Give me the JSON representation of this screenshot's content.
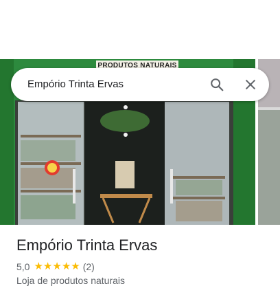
{
  "colors": {
    "accent_star": "#fbbc04",
    "storefront_green": "#2d8a3e"
  },
  "photo": {
    "sign_text": "PRODUTOS NATURAIS"
  },
  "search": {
    "query": "Empório Trinta Ervas",
    "search_icon": "search-icon",
    "close_icon": "close-icon"
  },
  "place": {
    "name": "Empório Trinta Ervas",
    "rating": "5,0",
    "stars": 5,
    "review_count": "(2)",
    "category": "Loja de produtos naturais"
  }
}
